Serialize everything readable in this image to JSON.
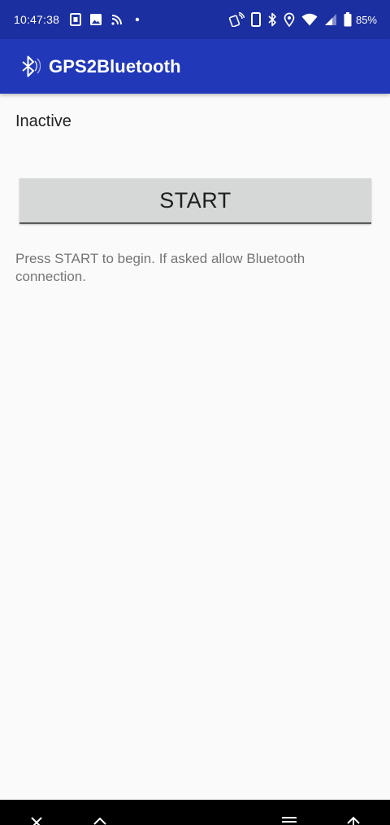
{
  "status_bar": {
    "time": "10:47:38",
    "battery": "85%",
    "left_icons": [
      "sim-card-icon",
      "image-icon",
      "cast-icon",
      "dot-icon"
    ],
    "right_icons": [
      "nfc-icon",
      "phone-icon",
      "bluetooth-icon",
      "location-icon",
      "wifi-icon",
      "signal-icon",
      "battery-icon"
    ]
  },
  "app_bar": {
    "icon": "bluetooth-icon",
    "title": "GPS2Bluetooth"
  },
  "main": {
    "status_text": "Inactive",
    "start_button_label": "START",
    "hint": "Press START to begin. If asked allow Bluetooth connection."
  },
  "nav_bar": {
    "icons": [
      "collapse-icon",
      "expand-icon",
      "menu-icon",
      "up-arrow-icon"
    ]
  },
  "colors": {
    "status_bar": "#1b2fa0",
    "app_bar": "#2138b9",
    "background": "#fafafa",
    "button": "#d6d7d7"
  }
}
